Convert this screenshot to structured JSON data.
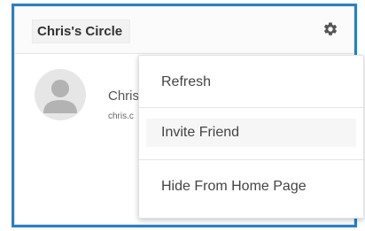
{
  "widget": {
    "title": "Chris's Circle"
  },
  "member": {
    "name": "Chris",
    "email": "chris.c"
  },
  "menu": {
    "items": [
      {
        "label": "Refresh"
      },
      {
        "label": "Invite Friend",
        "highlighted": true
      },
      {
        "label": "Hide From Home Page"
      }
    ]
  },
  "colors": {
    "frame_border": "#2980c5",
    "gear_icon": "#555555"
  },
  "icons": {
    "settings": "gear-icon",
    "avatar": "person-placeholder-icon"
  }
}
